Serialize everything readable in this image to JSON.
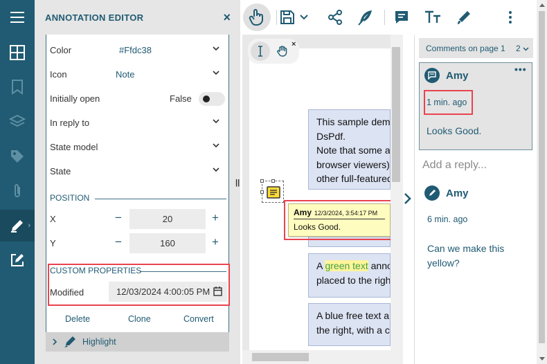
{
  "rail": {
    "items": [
      {
        "name": "menu-icon"
      },
      {
        "name": "thumbnails-icon"
      },
      {
        "name": "bookmark-icon"
      },
      {
        "name": "layers-icon"
      },
      {
        "name": "tag-icon"
      },
      {
        "name": "attachment-icon"
      },
      {
        "name": "annotation-editor-icon",
        "active": true
      },
      {
        "name": "form-editor-icon"
      }
    ]
  },
  "editor": {
    "title": "ANNOTATION EDITOR",
    "close": "×",
    "props": {
      "color_label": "Color",
      "color_value": "#Ffdc38",
      "icon_label": "Icon",
      "icon_value": "Note",
      "initially_open_label": "Initially open",
      "initially_open_value": "False",
      "in_reply_to_label": "In reply to",
      "state_model_label": "State model",
      "state_label": "State"
    },
    "position": {
      "title": "POSITION",
      "x_label": "X",
      "x_value": "20",
      "y_label": "Y",
      "y_value": "160",
      "minus": "−",
      "plus": "+"
    },
    "custom": {
      "title": "CUSTOM PROPERTIES",
      "modified_label": "Modified",
      "modified_value": "12/03/2024 4:00:05 PM"
    },
    "actions": {
      "delete": "Delete",
      "clone": "Clone",
      "convert": "Convert"
    },
    "footer": {
      "label": "Highlight"
    }
  },
  "toolbar": {
    "tools": [
      "pan-tool",
      "save",
      "save-dropdown",
      "share",
      "sign",
      "comment",
      "text",
      "pen",
      "more"
    ]
  },
  "document": {
    "box1_lines": [
      "This sample dem",
      "DsPdf.",
      "Note that some a",
      "browser viewers)",
      "other full-featured"
    ],
    "box2_before": "A ",
    "box2_highlight": "green text",
    "box2_after": " anno",
    "box2_line2": "placed to the righ",
    "box3_lines": [
      "A blue free text a",
      "the right, with a c"
    ],
    "popup": {
      "author": "Amy",
      "date": "12/3/2024, 3:54:17 PM",
      "text": "Looks Good."
    }
  },
  "comments": {
    "header": "Comments on page 1",
    "count": "2",
    "items": [
      {
        "author": "Amy",
        "time": "1 min. ago",
        "text": "Looks Good."
      },
      {
        "author": "Amy",
        "time": "6 min. ago",
        "text_line1": "Can we make this",
        "text_line2": "yellow?"
      }
    ],
    "more": "•••",
    "reply_placeholder": "Add a reply..."
  },
  "colors": {
    "accent": "#205b73",
    "highlight_border": "#e8434f",
    "note_color": "#ffdc38"
  }
}
